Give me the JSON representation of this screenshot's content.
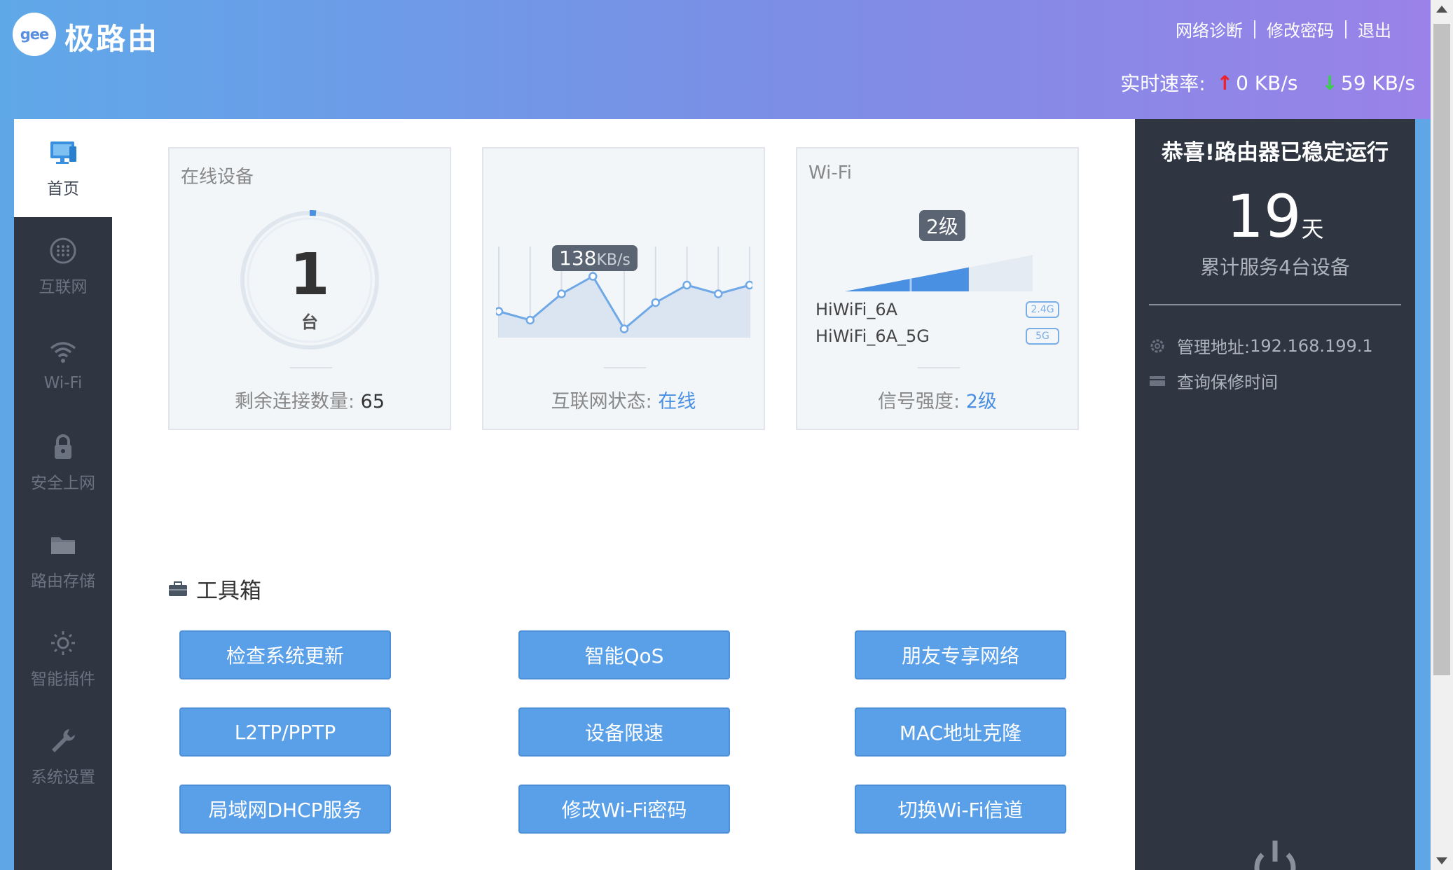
{
  "header": {
    "logo_mark": "gee",
    "brand": "极路由",
    "links": [
      "网络诊断",
      "修改密码",
      "退出"
    ],
    "speed_label": "实时速率:",
    "upload_arrow": "↑",
    "upload": "0 KB/s",
    "download_arrow": "↓",
    "download": "59 KB/s"
  },
  "sidebar": {
    "items": [
      {
        "label": "首页",
        "icon": "monitor-icon",
        "active": true
      },
      {
        "label": "互联网",
        "icon": "globe-icon",
        "active": false
      },
      {
        "label": "Wi-Fi",
        "icon": "wifi-icon",
        "active": false
      },
      {
        "label": "安全上网",
        "icon": "lock-icon",
        "active": false
      },
      {
        "label": "路由存储",
        "icon": "folder-icon",
        "active": false
      },
      {
        "label": "智能插件",
        "icon": "sun-icon",
        "active": false
      },
      {
        "label": "系统设置",
        "icon": "wrench-icon",
        "active": false
      }
    ]
  },
  "cards": {
    "devices": {
      "title": "在线设备",
      "count": "1",
      "unit": "台",
      "remaining_label": "剩余连接数量:",
      "remaining_value": "65"
    },
    "internet": {
      "speed_value": "138",
      "speed_unit": "KB/s",
      "status_label": "互联网状态:",
      "status_value": "在线",
      "chart_data": {
        "type": "area",
        "values": [
          3,
          2,
          5,
          7,
          1,
          4,
          6,
          5,
          6
        ]
      }
    },
    "wifi": {
      "title": "Wi-Fi",
      "level_badge": "2级",
      "ssids": [
        {
          "name": "HiWiFi_6A",
          "band": "2.4G"
        },
        {
          "name": "HiWiFi_6A_5G",
          "band": "5G"
        }
      ],
      "strength_label": "信号强度:",
      "strength_value": "2级",
      "signal_fraction": 0.66
    }
  },
  "toolbox": {
    "title": "工具箱",
    "buttons": [
      "检查系统更新",
      "智能QoS",
      "朋友专享网络",
      "L2TP/PPTP",
      "设备限速",
      "MAC地址克隆",
      "局域网DHCP服务",
      "修改Wi-Fi密码",
      "切换Wi-Fi信道"
    ]
  },
  "right_panel": {
    "title": "恭喜!路由器已稳定运行",
    "days": "19",
    "days_unit": "天",
    "served": "累计服务4台设备",
    "admin_label": "管理地址:",
    "admin_address": "192.168.199.1",
    "warranty": "查询保修时间"
  },
  "colors": {
    "accent": "#4a90e2",
    "button": "#5aa0e8",
    "sidebar": "#2f3541"
  }
}
